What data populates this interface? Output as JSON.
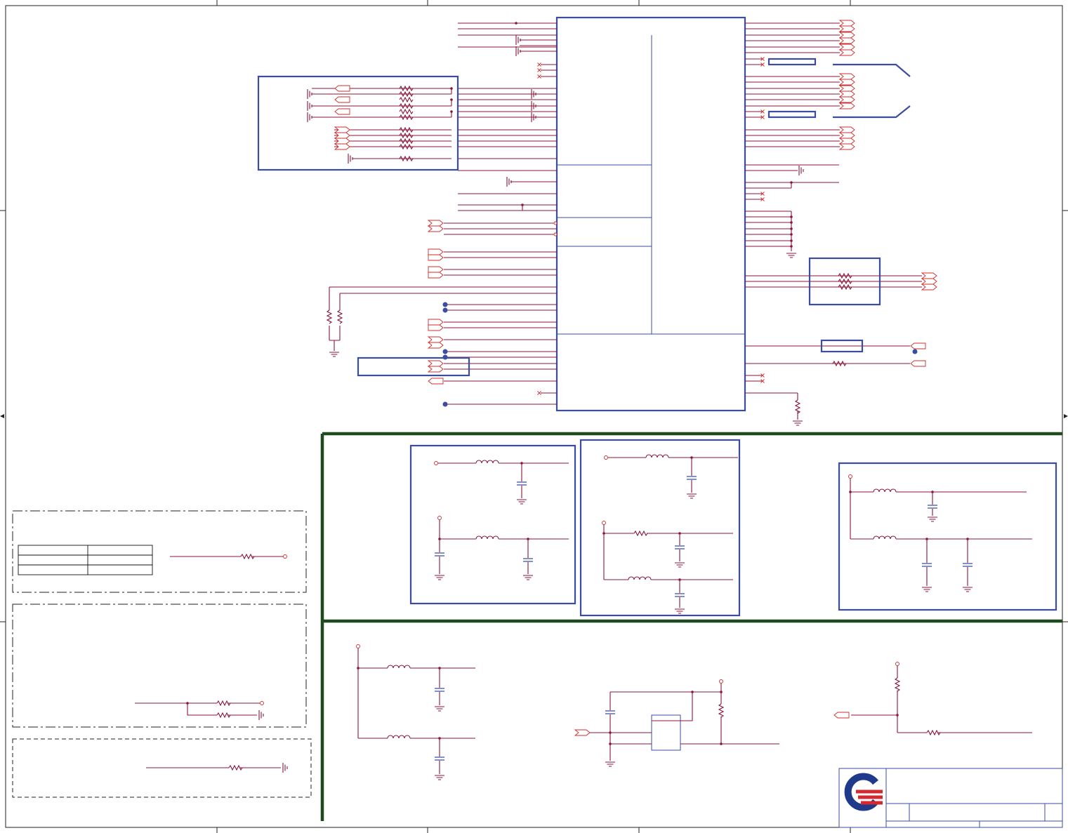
{
  "sheet": {
    "width": 1521,
    "height": 1187,
    "colors": {
      "wire": "#8b1538",
      "pin": "#d12c2c",
      "box": "#3a4da0",
      "divider": "#1e4a1e",
      "logo_blue": "#1f3a8a",
      "logo_red": "#d42a2f"
    }
  },
  "logo": {
    "icon": "company-logo-icon"
  },
  "title_block": {
    "rows": 3
  }
}
